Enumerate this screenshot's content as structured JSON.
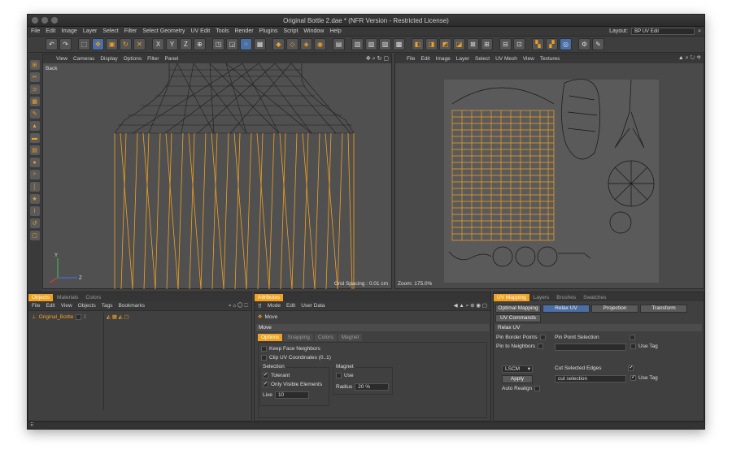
{
  "window": {
    "title": "Original Bottle 2.dae * (NFR Version - Restricted License)"
  },
  "menu": [
    "File",
    "Edit",
    "Image",
    "Layer",
    "Select",
    "Filter",
    "Select Geometry",
    "UV Edit",
    "Tools",
    "Render",
    "Plugins",
    "Script",
    "Window",
    "Help"
  ],
  "layout": {
    "label": "Layout:",
    "value": "BP UV Edit"
  },
  "viewport": {
    "menu": [
      "View",
      "Cameras",
      "Display",
      "Options",
      "Filter",
      "Panel"
    ],
    "label": "Back",
    "grid_spacing": "Grid Spacing : 0.01 cm",
    "axis_labels": {
      "y": "Y",
      "z": "Z"
    }
  },
  "uv_view": {
    "menu": [
      "File",
      "Edit",
      "Image",
      "Layer",
      "Select",
      "UV Mesh",
      "View",
      "Textures"
    ],
    "zoom": "Zoom: 175.0%"
  },
  "objects_panel": {
    "tabs": [
      "Objects",
      "Materials",
      "Colors"
    ],
    "menu": [
      "File",
      "Edit",
      "View",
      "Objects",
      "Tags",
      "Bookmarks"
    ],
    "object_name": "Original_Bottle"
  },
  "attributes_panel": {
    "tab": "Attributes",
    "menu": [
      "Mode",
      "Edit",
      "User Data"
    ],
    "tool_name": "Move",
    "section": "Move",
    "subtabs": [
      "Options",
      "Snapping",
      "Colors",
      "Magnet"
    ],
    "keep_face_neighbors": "Keep Face Neighbors",
    "clip_uv": "Clip UV Coordinates (0..1)",
    "selection_group": "Selection",
    "tolerant": "Tolerant",
    "only_visible": "Only Visible Elements",
    "live_label": "Live",
    "live_value": "10",
    "magnet_group": "Magnet",
    "use_label": "Use",
    "radius_label": "Radius",
    "radius_value": "20 %"
  },
  "uv_panel": {
    "tabs": [
      "UV Mapping",
      "Layers",
      "Brushes",
      "Swatches"
    ],
    "mode_buttons": [
      "Optimal Mapping",
      "Relax UV",
      "Projection",
      "Transform"
    ],
    "uv_commands": "UV Commands",
    "section": "Relax UV",
    "pin_border": "Pin Border Points",
    "pin_to_neighbors": "Pin to Neighbors",
    "pin_point_selection": "Pin Point Selection",
    "use_tag": "Use Tag",
    "method": "LSCM",
    "apply": "Apply",
    "auto_realign": "Auto Realign",
    "cut_selected_edges": "Cut Selected Edges",
    "cut_selection": "cut selection",
    "use_tag_2": "Use Tag"
  },
  "colors": {
    "accent": "#f2a020",
    "selected": "#4a6fa5"
  }
}
